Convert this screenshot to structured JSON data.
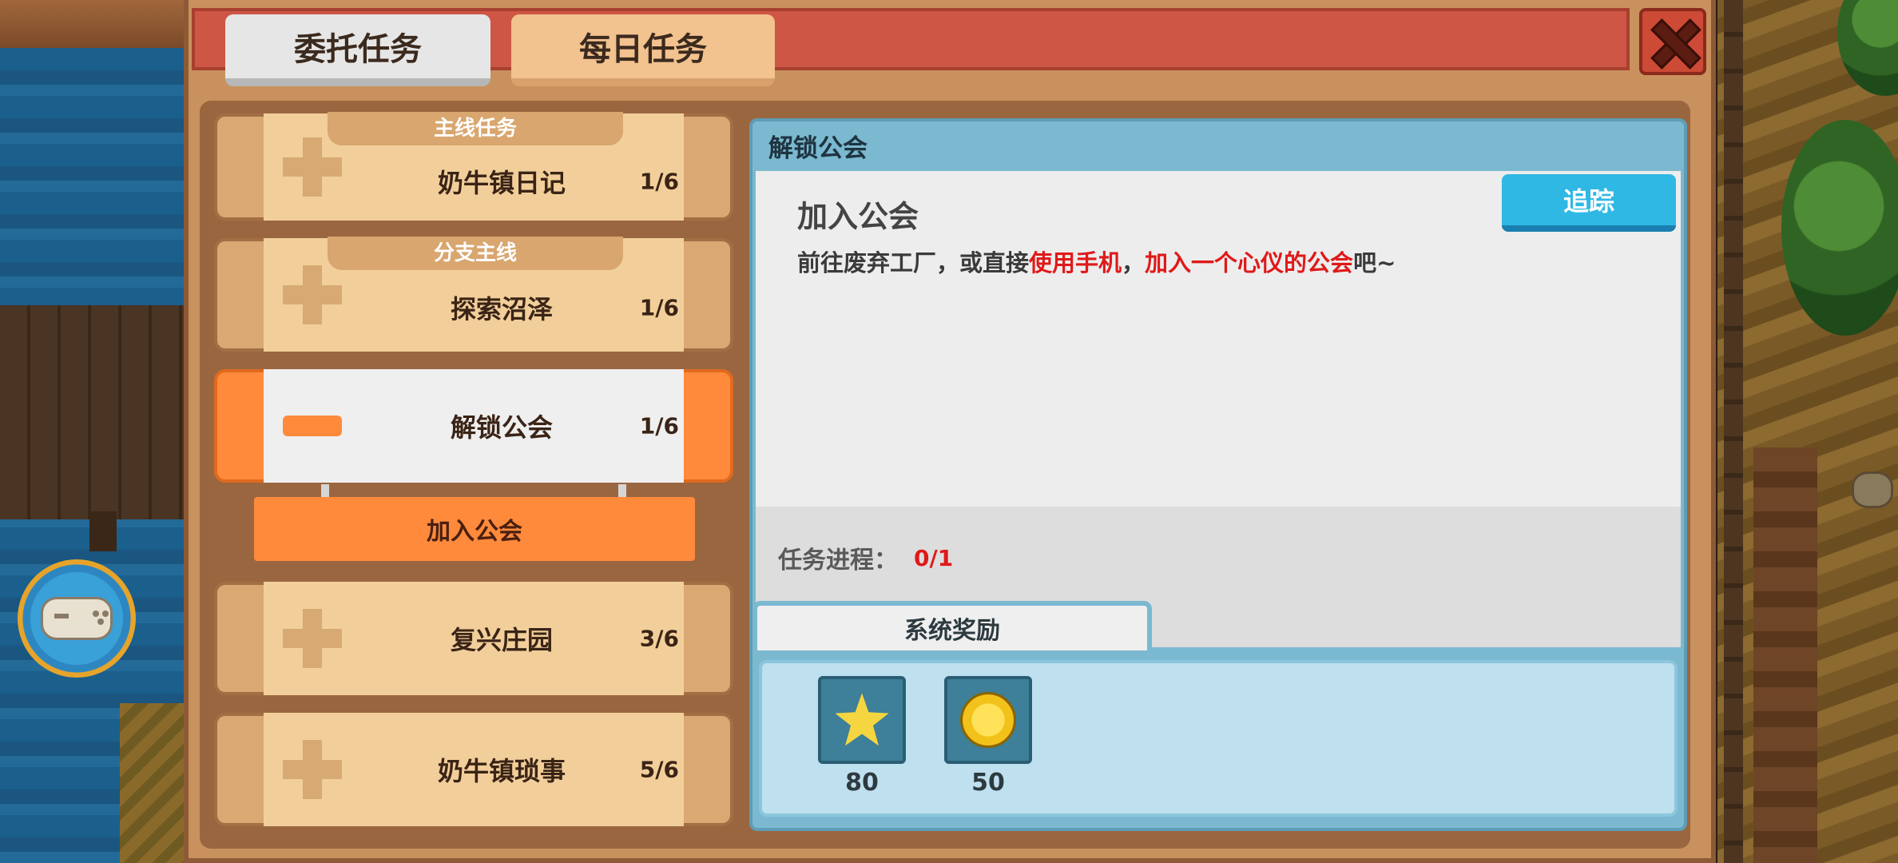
{
  "tabs": {
    "commission": "委托任务",
    "daily": "每日任务"
  },
  "quests": [
    {
      "category": "主线任务",
      "name": "奶牛镇日记",
      "progress": "1/6",
      "expanded": false
    },
    {
      "category": "分支主线",
      "name": "探索沼泽",
      "progress": "1/6",
      "expanded": false
    },
    {
      "category": "",
      "name": "解锁公会",
      "progress": "1/6",
      "expanded": true
    },
    {
      "category": "",
      "name": "复兴庄园",
      "progress": "3/6",
      "expanded": false
    },
    {
      "category": "",
      "name": "奶牛镇琐事",
      "progress": "5/6",
      "expanded": false
    }
  ],
  "subtask": "加入公会",
  "detail": {
    "title": "解锁公会",
    "subtitle": "加入公会",
    "desc_part1": "前往废弃工厂，或直接",
    "desc_red1": "使用手机",
    "desc_part2": "，",
    "desc_red2": "加入一个心仪的公会",
    "desc_part3": "吧~",
    "track_button": "追踪",
    "progress_label": "任务进程：",
    "progress_value": "0/1",
    "reward_tab": "系统奖励",
    "rewards": [
      {
        "icon": "star-icon",
        "amount": "80"
      },
      {
        "icon": "coin-icon",
        "amount": "50"
      }
    ]
  },
  "colors": {
    "accent_orange": "#ff8a3c",
    "track_blue": "#2fb8e4",
    "highlight_red": "#e01919",
    "header_red": "#cd5645"
  }
}
